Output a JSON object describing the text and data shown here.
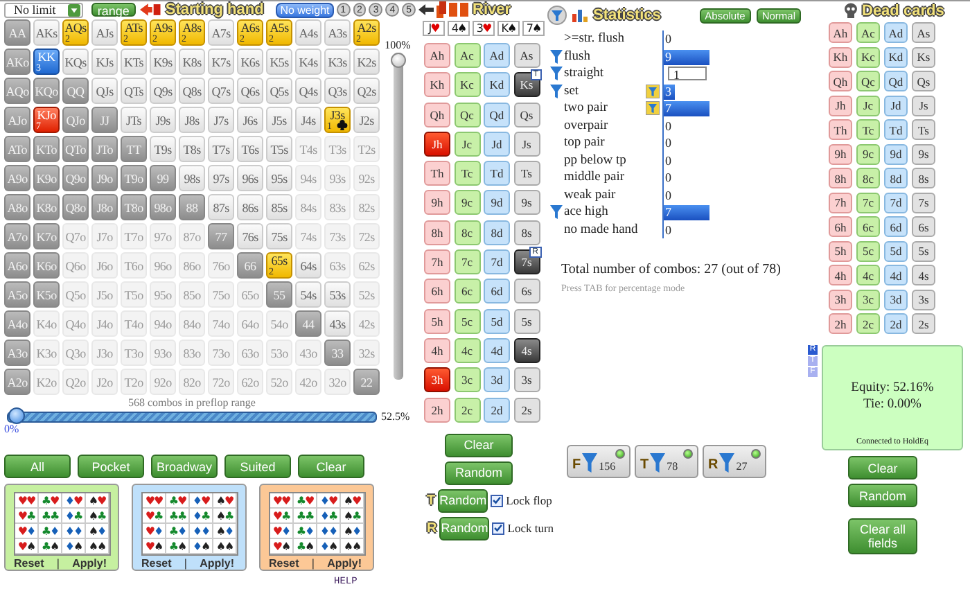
{
  "toolbar": {
    "game": "No limit",
    "range_button": "range",
    "title": "Starting hand",
    "weight_button": "No weight",
    "weight_slots": [
      "1",
      "2",
      "3",
      "4",
      "5"
    ]
  },
  "hand_grid": [
    [
      {
        "label": "AA",
        "kind": "in"
      },
      {
        "label": "AKs",
        "kind": "out"
      },
      {
        "label": "AQs",
        "kind": "gold",
        "weight": "2"
      },
      {
        "label": "AJs",
        "kind": "out"
      },
      {
        "label": "ATs",
        "kind": "gold",
        "weight": "2"
      },
      {
        "label": "A9s",
        "kind": "gold",
        "weight": "2"
      },
      {
        "label": "A8s",
        "kind": "gold",
        "weight": "2"
      },
      {
        "label": "A7s",
        "kind": "out"
      },
      {
        "label": "A6s",
        "kind": "gold",
        "weight": "2"
      },
      {
        "label": "A5s",
        "kind": "gold",
        "weight": "2"
      },
      {
        "label": "A4s",
        "kind": "out"
      },
      {
        "label": "A3s",
        "kind": "out"
      },
      {
        "label": "A2s",
        "kind": "gold",
        "weight": "2"
      }
    ],
    [
      {
        "label": "AKo",
        "kind": "in"
      },
      {
        "label": "KK",
        "kind": "blue",
        "weight": "3"
      },
      {
        "label": "KQs",
        "kind": "out"
      },
      {
        "label": "KJs",
        "kind": "out"
      },
      {
        "label": "KTs",
        "kind": "out"
      },
      {
        "label": "K9s",
        "kind": "out"
      },
      {
        "label": "K8s",
        "kind": "out"
      },
      {
        "label": "K7s",
        "kind": "out"
      },
      {
        "label": "K6s",
        "kind": "out"
      },
      {
        "label": "K5s",
        "kind": "out"
      },
      {
        "label": "K4s",
        "kind": "out"
      },
      {
        "label": "K3s",
        "kind": "out"
      },
      {
        "label": "K2s",
        "kind": "out"
      }
    ],
    [
      {
        "label": "AQo",
        "kind": "in"
      },
      {
        "label": "KQo",
        "kind": "in"
      },
      {
        "label": "QQ",
        "kind": "in"
      },
      {
        "label": "QJs",
        "kind": "out"
      },
      {
        "label": "QTs",
        "kind": "out"
      },
      {
        "label": "Q9s",
        "kind": "out"
      },
      {
        "label": "Q8s",
        "kind": "out"
      },
      {
        "label": "Q7s",
        "kind": "out"
      },
      {
        "label": "Q6s",
        "kind": "out"
      },
      {
        "label": "Q5s",
        "kind": "out"
      },
      {
        "label": "Q4s",
        "kind": "out"
      },
      {
        "label": "Q3s",
        "kind": "out"
      },
      {
        "label": "Q2s",
        "kind": "out"
      }
    ],
    [
      {
        "label": "AJo",
        "kind": "in"
      },
      {
        "label": "KJo",
        "kind": "red",
        "weight": "7"
      },
      {
        "label": "QJo",
        "kind": "in"
      },
      {
        "label": "JJ",
        "kind": "in"
      },
      {
        "label": "JTs",
        "kind": "out"
      },
      {
        "label": "J9s",
        "kind": "out"
      },
      {
        "label": "J8s",
        "kind": "out"
      },
      {
        "label": "J7s",
        "kind": "out"
      },
      {
        "label": "J6s",
        "kind": "out"
      },
      {
        "label": "J5s",
        "kind": "out"
      },
      {
        "label": "J4s",
        "kind": "out"
      },
      {
        "label": "J3s",
        "kind": "gold-marked",
        "weight": "1"
      },
      {
        "label": "J2s",
        "kind": "out"
      }
    ],
    [
      {
        "label": "ATo",
        "kind": "in"
      },
      {
        "label": "KTo",
        "kind": "in"
      },
      {
        "label": "QTo",
        "kind": "in"
      },
      {
        "label": "JTo",
        "kind": "in"
      },
      {
        "label": "TT",
        "kind": "in"
      },
      {
        "label": "T9s",
        "kind": "out"
      },
      {
        "label": "T8s",
        "kind": "out"
      },
      {
        "label": "T7s",
        "kind": "out"
      },
      {
        "label": "T6s",
        "kind": "out"
      },
      {
        "label": "T5s",
        "kind": "out"
      },
      {
        "label": "T4s",
        "kind": "dim"
      },
      {
        "label": "T3s",
        "kind": "dim"
      },
      {
        "label": "T2s",
        "kind": "dim"
      }
    ],
    [
      {
        "label": "A9o",
        "kind": "in"
      },
      {
        "label": "K9o",
        "kind": "in"
      },
      {
        "label": "Q9o",
        "kind": "in"
      },
      {
        "label": "J9o",
        "kind": "in"
      },
      {
        "label": "T9o",
        "kind": "in"
      },
      {
        "label": "99",
        "kind": "in"
      },
      {
        "label": "98s",
        "kind": "out"
      },
      {
        "label": "97s",
        "kind": "out"
      },
      {
        "label": "96s",
        "kind": "out"
      },
      {
        "label": "95s",
        "kind": "out"
      },
      {
        "label": "94s",
        "kind": "dim"
      },
      {
        "label": "93s",
        "kind": "dim"
      },
      {
        "label": "92s",
        "kind": "dim"
      }
    ],
    [
      {
        "label": "A8o",
        "kind": "in"
      },
      {
        "label": "K8o",
        "kind": "in"
      },
      {
        "label": "Q8o",
        "kind": "in"
      },
      {
        "label": "J8o",
        "kind": "in"
      },
      {
        "label": "T8o",
        "kind": "in"
      },
      {
        "label": "98o",
        "kind": "in"
      },
      {
        "label": "88",
        "kind": "in"
      },
      {
        "label": "87s",
        "kind": "out"
      },
      {
        "label": "86s",
        "kind": "out"
      },
      {
        "label": "85s",
        "kind": "out"
      },
      {
        "label": "84s",
        "kind": "dim"
      },
      {
        "label": "83s",
        "kind": "dim"
      },
      {
        "label": "82s",
        "kind": "dim"
      }
    ],
    [
      {
        "label": "A7o",
        "kind": "in"
      },
      {
        "label": "K7o",
        "kind": "in"
      },
      {
        "label": "Q7o",
        "kind": "dim"
      },
      {
        "label": "J7o",
        "kind": "dim"
      },
      {
        "label": "T7o",
        "kind": "dim"
      },
      {
        "label": "97o",
        "kind": "dim"
      },
      {
        "label": "87o",
        "kind": "dim"
      },
      {
        "label": "77",
        "kind": "in"
      },
      {
        "label": "76s",
        "kind": "out"
      },
      {
        "label": "75s",
        "kind": "out"
      },
      {
        "label": "74s",
        "kind": "dim"
      },
      {
        "label": "73s",
        "kind": "dim"
      },
      {
        "label": "72s",
        "kind": "dim"
      }
    ],
    [
      {
        "label": "A6o",
        "kind": "in"
      },
      {
        "label": "K6o",
        "kind": "in"
      },
      {
        "label": "Q6o",
        "kind": "dim"
      },
      {
        "label": "J6o",
        "kind": "dim"
      },
      {
        "label": "T6o",
        "kind": "dim"
      },
      {
        "label": "96o",
        "kind": "dim"
      },
      {
        "label": "86o",
        "kind": "dim"
      },
      {
        "label": "76o",
        "kind": "dim"
      },
      {
        "label": "66",
        "kind": "in"
      },
      {
        "label": "65s",
        "kind": "gold",
        "weight": "2"
      },
      {
        "label": "64s",
        "kind": "out"
      },
      {
        "label": "63s",
        "kind": "dim"
      },
      {
        "label": "62s",
        "kind": "dim"
      }
    ],
    [
      {
        "label": "A5o",
        "kind": "in"
      },
      {
        "label": "K5o",
        "kind": "in"
      },
      {
        "label": "Q5o",
        "kind": "dim"
      },
      {
        "label": "J5o",
        "kind": "dim"
      },
      {
        "label": "T5o",
        "kind": "dim"
      },
      {
        "label": "95o",
        "kind": "dim"
      },
      {
        "label": "85o",
        "kind": "dim"
      },
      {
        "label": "75o",
        "kind": "dim"
      },
      {
        "label": "65o",
        "kind": "dim"
      },
      {
        "label": "55",
        "kind": "in"
      },
      {
        "label": "54s",
        "kind": "out"
      },
      {
        "label": "53s",
        "kind": "out"
      },
      {
        "label": "52s",
        "kind": "dim"
      }
    ],
    [
      {
        "label": "A4o",
        "kind": "in"
      },
      {
        "label": "K4o",
        "kind": "dim"
      },
      {
        "label": "Q4o",
        "kind": "dim"
      },
      {
        "label": "J4o",
        "kind": "dim"
      },
      {
        "label": "T4o",
        "kind": "dim"
      },
      {
        "label": "94o",
        "kind": "dim"
      },
      {
        "label": "84o",
        "kind": "dim"
      },
      {
        "label": "74o",
        "kind": "dim"
      },
      {
        "label": "64o",
        "kind": "dim"
      },
      {
        "label": "54o",
        "kind": "dim"
      },
      {
        "label": "44",
        "kind": "in"
      },
      {
        "label": "43s",
        "kind": "out"
      },
      {
        "label": "42s",
        "kind": "dim"
      }
    ],
    [
      {
        "label": "A3o",
        "kind": "in"
      },
      {
        "label": "K3o",
        "kind": "dim"
      },
      {
        "label": "Q3o",
        "kind": "dim"
      },
      {
        "label": "J3o",
        "kind": "dim"
      },
      {
        "label": "T3o",
        "kind": "dim"
      },
      {
        "label": "93o",
        "kind": "dim"
      },
      {
        "label": "83o",
        "kind": "dim"
      },
      {
        "label": "73o",
        "kind": "dim"
      },
      {
        "label": "63o",
        "kind": "dim"
      },
      {
        "label": "53o",
        "kind": "dim"
      },
      {
        "label": "43o",
        "kind": "dim"
      },
      {
        "label": "33",
        "kind": "in"
      },
      {
        "label": "32s",
        "kind": "dim"
      }
    ],
    [
      {
        "label": "A2o",
        "kind": "in"
      },
      {
        "label": "K2o",
        "kind": "dim"
      },
      {
        "label": "Q2o",
        "kind": "dim"
      },
      {
        "label": "J2o",
        "kind": "dim"
      },
      {
        "label": "T2o",
        "kind": "dim"
      },
      {
        "label": "92o",
        "kind": "dim"
      },
      {
        "label": "82o",
        "kind": "dim"
      },
      {
        "label": "72o",
        "kind": "dim"
      },
      {
        "label": "62o",
        "kind": "dim"
      },
      {
        "label": "52o",
        "kind": "dim"
      },
      {
        "label": "42o",
        "kind": "dim"
      },
      {
        "label": "32o",
        "kind": "dim"
      },
      {
        "label": "22",
        "kind": "in"
      }
    ]
  ],
  "vertical_slider": {
    "label": "100%",
    "level": 1
  },
  "combos_text": "568 combos in preflop range",
  "horizontal_slider": {
    "min_label": "0%",
    "max_label": "52.5%",
    "level": 0
  },
  "range_buttons": [
    "All",
    "Pocket",
    "Broadway",
    "Suited",
    "Clear"
  ],
  "suit_panels": [
    {
      "color": "#c6f0a0",
      "reset": "Reset",
      "separator": "|",
      "apply": "Apply!",
      "cells": [
        [
          [
            {
              "symbol": "♥",
              "color": "#d81c1c"
            },
            {
              "symbol": "♥",
              "color": "#d81c1c"
            }
          ],
          [
            {
              "symbol": "♣",
              "color": "#14892c"
            },
            {
              "symbol": "♥",
              "color": "#d81c1c"
            }
          ],
          [
            {
              "symbol": "♦",
              "color": "#1660b8"
            },
            {
              "symbol": "♥",
              "color": "#d81c1c"
            }
          ],
          [
            {
              "symbol": "♠",
              "color": "#222222"
            },
            {
              "symbol": "♥",
              "color": "#d81c1c"
            }
          ]
        ],
        [
          [
            {
              "symbol": "♥",
              "color": "#d81c1c"
            },
            {
              "symbol": "♣",
              "color": "#14892c"
            }
          ],
          [
            {
              "symbol": "♣",
              "color": "#14892c"
            },
            {
              "symbol": "♣",
              "color": "#14892c"
            }
          ],
          [
            {
              "symbol": "♦",
              "color": "#1660b8"
            },
            {
              "symbol": "♣",
              "color": "#14892c"
            }
          ],
          [
            {
              "symbol": "♠",
              "color": "#222222"
            },
            {
              "symbol": "♣",
              "color": "#14892c"
            }
          ]
        ],
        [
          [
            {
              "symbol": "♥",
              "color": "#d81c1c"
            },
            {
              "symbol": "♦",
              "color": "#1660b8"
            }
          ],
          [
            {
              "symbol": "♣",
              "color": "#14892c"
            },
            {
              "symbol": "♦",
              "color": "#1660b8"
            }
          ],
          [
            {
              "symbol": "♦",
              "color": "#1660b8"
            },
            {
              "symbol": "♦",
              "color": "#1660b8"
            }
          ],
          [
            {
              "symbol": "♠",
              "color": "#222222"
            },
            {
              "symbol": "♦",
              "color": "#1660b8"
            }
          ]
        ],
        [
          [
            {
              "symbol": "♥",
              "color": "#d81c1c"
            },
            {
              "symbol": "♠",
              "color": "#222222"
            }
          ],
          [
            {
              "symbol": "♣",
              "color": "#14892c"
            },
            {
              "symbol": "♠",
              "color": "#222222"
            }
          ],
          [
            {
              "symbol": "♦",
              "color": "#1660b8"
            },
            {
              "symbol": "♠",
              "color": "#222222"
            }
          ],
          [
            {
              "symbol": "♠",
              "color": "#222222"
            },
            {
              "symbol": "♠",
              "color": "#222222"
            }
          ]
        ]
      ]
    },
    {
      "color": "#bfe0fa",
      "reset": "Reset",
      "separator": "|",
      "apply": "Apply!",
      "cells": [
        [
          [
            {
              "symbol": "♥",
              "color": "#d81c1c"
            },
            {
              "symbol": "♥",
              "color": "#d81c1c"
            }
          ],
          [
            {
              "symbol": "♣",
              "color": "#14892c"
            },
            {
              "symbol": "♥",
              "color": "#d81c1c"
            }
          ],
          [
            {
              "symbol": "♦",
              "color": "#1660b8"
            },
            {
              "symbol": "♥",
              "color": "#d81c1c"
            }
          ],
          [
            {
              "symbol": "♠",
              "color": "#222222"
            },
            {
              "symbol": "♥",
              "color": "#d81c1c"
            }
          ]
        ],
        [
          [
            {
              "symbol": "♥",
              "color": "#d81c1c"
            },
            {
              "symbol": "♣",
              "color": "#14892c"
            }
          ],
          [
            {
              "symbol": "♣",
              "color": "#14892c"
            },
            {
              "symbol": "♣",
              "color": "#14892c"
            }
          ],
          [
            {
              "symbol": "♦",
              "color": "#1660b8"
            },
            {
              "symbol": "♣",
              "color": "#14892c"
            }
          ],
          [
            {
              "symbol": "♠",
              "color": "#222222"
            },
            {
              "symbol": "♣",
              "color": "#14892c"
            }
          ]
        ],
        [
          [
            {
              "symbol": "♥",
              "color": "#d81c1c"
            },
            {
              "symbol": "♦",
              "color": "#1660b8"
            }
          ],
          [
            {
              "symbol": "♣",
              "color": "#14892c"
            },
            {
              "symbol": "♦",
              "color": "#1660b8"
            }
          ],
          [
            {
              "symbol": "♦",
              "color": "#1660b8"
            },
            {
              "symbol": "♦",
              "color": "#1660b8"
            }
          ],
          [
            {
              "symbol": "♠",
              "color": "#222222"
            },
            {
              "symbol": "♦",
              "color": "#1660b8"
            }
          ]
        ],
        [
          [
            {
              "symbol": "♥",
              "color": "#d81c1c"
            },
            {
              "symbol": "♠",
              "color": "#222222"
            }
          ],
          [
            {
              "symbol": "♣",
              "color": "#14892c"
            },
            {
              "symbol": "♠",
              "color": "#222222"
            }
          ],
          [
            {
              "symbol": "♦",
              "color": "#1660b8"
            },
            {
              "symbol": "♠",
              "color": "#222222"
            }
          ],
          [
            {
              "symbol": "♠",
              "color": "#222222"
            },
            {
              "symbol": "♠",
              "color": "#222222"
            }
          ]
        ]
      ]
    },
    {
      "color": "#fcc896",
      "reset": "Reset",
      "separator": "|",
      "apply": "Apply!",
      "cells": [
        [
          [
            {
              "symbol": "♥",
              "color": "#d81c1c"
            },
            {
              "symbol": "♥",
              "color": "#d81c1c"
            }
          ],
          [
            {
              "symbol": "♣",
              "color": "#14892c"
            },
            {
              "symbol": "♥",
              "color": "#d81c1c"
            }
          ],
          [
            {
              "symbol": "♦",
              "color": "#1660b8"
            },
            {
              "symbol": "♥",
              "color": "#d81c1c"
            }
          ],
          [
            {
              "symbol": "♠",
              "color": "#222222"
            },
            {
              "symbol": "♥",
              "color": "#d81c1c"
            }
          ]
        ],
        [
          [
            {
              "symbol": "♥",
              "color": "#d81c1c"
            },
            {
              "symbol": "♣",
              "color": "#14892c"
            }
          ],
          [
            {
              "symbol": "♣",
              "color": "#14892c"
            },
            {
              "symbol": "♣",
              "color": "#14892c"
            }
          ],
          [
            {
              "symbol": "♦",
              "color": "#1660b8"
            },
            {
              "symbol": "♣",
              "color": "#14892c"
            }
          ],
          [
            {
              "symbol": "♠",
              "color": "#222222"
            },
            {
              "symbol": "♣",
              "color": "#14892c"
            }
          ]
        ],
        [
          [
            {
              "symbol": "♥",
              "color": "#d81c1c"
            },
            {
              "symbol": "♦",
              "color": "#1660b8"
            }
          ],
          [
            {
              "symbol": "♣",
              "color": "#14892c"
            },
            {
              "symbol": "♦",
              "color": "#1660b8"
            }
          ],
          [
            {
              "symbol": "♦",
              "color": "#1660b8"
            },
            {
              "symbol": "♦",
              "color": "#1660b8"
            }
          ],
          [
            {
              "symbol": "♠",
              "color": "#222222"
            },
            {
              "symbol": "♦",
              "color": "#1660b8"
            }
          ]
        ],
        [
          [
            {
              "symbol": "♥",
              "color": "#d81c1c"
            },
            {
              "symbol": "♠",
              "color": "#222222"
            }
          ],
          [
            {
              "symbol": "♣",
              "color": "#14892c"
            },
            {
              "symbol": "♠",
              "color": "#222222"
            }
          ],
          [
            {
              "symbol": "♦",
              "color": "#1660b8"
            },
            {
              "symbol": "♠",
              "color": "#222222"
            }
          ],
          [
            {
              "symbol": "♠",
              "color": "#222222"
            },
            {
              "symbol": "♠",
              "color": "#222222"
            }
          ]
        ]
      ]
    }
  ],
  "help": "HELP",
  "river": {
    "title": "River",
    "board": [
      {
        "rank": "J",
        "suit": "♥",
        "color": "#e00000"
      },
      {
        "rank": "4",
        "suit": "♠",
        "color": "#111111"
      },
      {
        "rank": "3",
        "suit": "♥",
        "color": "#e00000"
      },
      {
        "rank": "K",
        "suit": "♠",
        "color": "#111111"
      },
      {
        "rank": "7",
        "suit": "♠",
        "color": "#111111"
      }
    ],
    "cards": [
      [
        {
          "label": "Ah",
          "kind": "hearts",
          "on_board": false
        },
        {
          "label": "Ac",
          "kind": "clubs",
          "on_board": false
        },
        {
          "label": "Ad",
          "kind": "diamonds",
          "on_board": false
        },
        {
          "label": "As",
          "kind": "spades",
          "on_board": false
        }
      ],
      [
        {
          "label": "Kh",
          "kind": "hearts",
          "on_board": false
        },
        {
          "label": "Kc",
          "kind": "clubs",
          "on_board": false
        },
        {
          "label": "Kd",
          "kind": "diamonds",
          "on_board": false
        },
        {
          "label": "Ks",
          "kind": "spades",
          "on_board": true,
          "badge": "T"
        }
      ],
      [
        {
          "label": "Qh",
          "kind": "hearts",
          "on_board": false
        },
        {
          "label": "Qc",
          "kind": "clubs",
          "on_board": false
        },
        {
          "label": "Qd",
          "kind": "diamonds",
          "on_board": false
        },
        {
          "label": "Qs",
          "kind": "spades",
          "on_board": false
        }
      ],
      [
        {
          "label": "Jh",
          "kind": "hearts",
          "on_board": true
        },
        {
          "label": "Jc",
          "kind": "clubs",
          "on_board": false
        },
        {
          "label": "Jd",
          "kind": "diamonds",
          "on_board": false
        },
        {
          "label": "Js",
          "kind": "spades",
          "on_board": false
        }
      ],
      [
        {
          "label": "Th",
          "kind": "hearts",
          "on_board": false
        },
        {
          "label": "Tc",
          "kind": "clubs",
          "on_board": false
        },
        {
          "label": "Td",
          "kind": "diamonds",
          "on_board": false
        },
        {
          "label": "Ts",
          "kind": "spades",
          "on_board": false
        }
      ],
      [
        {
          "label": "9h",
          "kind": "hearts",
          "on_board": false
        },
        {
          "label": "9c",
          "kind": "clubs",
          "on_board": false
        },
        {
          "label": "9d",
          "kind": "diamonds",
          "on_board": false
        },
        {
          "label": "9s",
          "kind": "spades",
          "on_board": false
        }
      ],
      [
        {
          "label": "8h",
          "kind": "hearts",
          "on_board": false
        },
        {
          "label": "8c",
          "kind": "clubs",
          "on_board": false
        },
        {
          "label": "8d",
          "kind": "diamonds",
          "on_board": false
        },
        {
          "label": "8s",
          "kind": "spades",
          "on_board": false
        }
      ],
      [
        {
          "label": "7h",
          "kind": "hearts",
          "on_board": false
        },
        {
          "label": "7c",
          "kind": "clubs",
          "on_board": false
        },
        {
          "label": "7d",
          "kind": "diamonds",
          "on_board": false
        },
        {
          "label": "7s",
          "kind": "spades",
          "on_board": true,
          "badge": "R"
        }
      ],
      [
        {
          "label": "6h",
          "kind": "hearts",
          "on_board": false
        },
        {
          "label": "6c",
          "kind": "clubs",
          "on_board": false
        },
        {
          "label": "6d",
          "kind": "diamonds",
          "on_board": false
        },
        {
          "label": "6s",
          "kind": "spades",
          "on_board": false
        }
      ],
      [
        {
          "label": "5h",
          "kind": "hearts",
          "on_board": false
        },
        {
          "label": "5c",
          "kind": "clubs",
          "on_board": false
        },
        {
          "label": "5d",
          "kind": "diamonds",
          "on_board": false
        },
        {
          "label": "5s",
          "kind": "spades",
          "on_board": false
        }
      ],
      [
        {
          "label": "4h",
          "kind": "hearts",
          "on_board": false
        },
        {
          "label": "4c",
          "kind": "clubs",
          "on_board": false
        },
        {
          "label": "4d",
          "kind": "diamonds",
          "on_board": false
        },
        {
          "label": "4s",
          "kind": "spades",
          "on_board": true
        }
      ],
      [
        {
          "label": "3h",
          "kind": "hearts",
          "on_board": true
        },
        {
          "label": "3c",
          "kind": "clubs",
          "on_board": false
        },
        {
          "label": "3d",
          "kind": "diamonds",
          "on_board": false
        },
        {
          "label": "3s",
          "kind": "spades",
          "on_board": false
        }
      ],
      [
        {
          "label": "2h",
          "kind": "hearts",
          "on_board": false
        },
        {
          "label": "2c",
          "kind": "clubs",
          "on_board": false
        },
        {
          "label": "2d",
          "kind": "diamonds",
          "on_board": false
        },
        {
          "label": "2s",
          "kind": "spades",
          "on_board": false
        }
      ]
    ]
  },
  "card_buttons": {
    "clear": "Clear",
    "random": "Random",
    "locks": [
      {
        "tag": "T",
        "button": "Random",
        "label": "Lock flop",
        "checked": true
      },
      {
        "tag": "R",
        "button": "Random",
        "label": "Lock turn",
        "checked": true
      }
    ]
  },
  "statistics": {
    "title": "Statistics",
    "modes": [
      "Absolute",
      "Normal"
    ],
    "rows": [
      {
        "label": ">=str. flush",
        "value": "0",
        "kind": "bar",
        "filtered": false,
        "pinned": false
      },
      {
        "label": "flush",
        "value": "9",
        "kind": "bar",
        "level": 0.33,
        "filtered": true,
        "pinned": false
      },
      {
        "label": "straight",
        "value": "1",
        "kind": "field",
        "filtered": true,
        "pinned": false
      },
      {
        "label": "set",
        "value": "3",
        "kind": "bar",
        "level": 0.08,
        "filtered": true,
        "pinned": true
      },
      {
        "label": "two pair",
        "value": "7",
        "kind": "bar",
        "level": 0.33,
        "filtered": false,
        "pinned": true
      },
      {
        "label": "overpair",
        "value": "0",
        "kind": "bar",
        "filtered": false,
        "pinned": false
      },
      {
        "label": "top pair",
        "value": "0",
        "kind": "bar",
        "filtered": false,
        "pinned": false
      },
      {
        "label": "pp below tp",
        "value": "0",
        "kind": "bar",
        "filtered": false,
        "pinned": false
      },
      {
        "label": "middle pair",
        "value": "0",
        "kind": "bar",
        "filtered": false,
        "pinned": false
      },
      {
        "label": "weak pair",
        "value": "0",
        "kind": "bar",
        "filtered": false,
        "pinned": false
      },
      {
        "label": "ace high",
        "value": "7",
        "kind": "bar",
        "level": 0.33,
        "filtered": true,
        "pinned": false
      },
      {
        "label": "no made hand",
        "value": "0",
        "kind": "bar",
        "filtered": false,
        "pinned": false
      }
    ],
    "total": "Total number of combos: 27 (out of 78)",
    "hint": "Press TAB for percentage mode"
  },
  "filters": [
    {
      "tag": "F",
      "count": "156",
      "on": true
    },
    {
      "tag": "T",
      "count": "78",
      "on": true
    },
    {
      "tag": "R",
      "count": "27",
      "on": true
    }
  ],
  "dead_cards": {
    "title": "Dead cards",
    "cards": [
      [
        {
          "label": "Ah",
          "kind": "hearts"
        },
        {
          "label": "Ac",
          "kind": "clubs"
        },
        {
          "label": "Ad",
          "kind": "diamonds"
        },
        {
          "label": "As",
          "kind": "spades"
        }
      ],
      [
        {
          "label": "Kh",
          "kind": "hearts"
        },
        {
          "label": "Kc",
          "kind": "clubs"
        },
        {
          "label": "Kd",
          "kind": "diamonds"
        },
        {
          "label": "Ks",
          "kind": "spades"
        }
      ],
      [
        {
          "label": "Qh",
          "kind": "hearts"
        },
        {
          "label": "Qc",
          "kind": "clubs"
        },
        {
          "label": "Qd",
          "kind": "diamonds"
        },
        {
          "label": "Qs",
          "kind": "spades"
        }
      ],
      [
        {
          "label": "Jh",
          "kind": "hearts"
        },
        {
          "label": "Jc",
          "kind": "clubs"
        },
        {
          "label": "Jd",
          "kind": "diamonds"
        },
        {
          "label": "Js",
          "kind": "spades"
        }
      ],
      [
        {
          "label": "Th",
          "kind": "hearts"
        },
        {
          "label": "Tc",
          "kind": "clubs"
        },
        {
          "label": "Td",
          "kind": "diamonds"
        },
        {
          "label": "Ts",
          "kind": "spades"
        }
      ],
      [
        {
          "label": "9h",
          "kind": "hearts"
        },
        {
          "label": "9c",
          "kind": "clubs"
        },
        {
          "label": "9d",
          "kind": "diamonds"
        },
        {
          "label": "9s",
          "kind": "spades"
        }
      ],
      [
        {
          "label": "8h",
          "kind": "hearts"
        },
        {
          "label": "8c",
          "kind": "clubs"
        },
        {
          "label": "8d",
          "kind": "diamonds"
        },
        {
          "label": "8s",
          "kind": "spades"
        }
      ],
      [
        {
          "label": "7h",
          "kind": "hearts"
        },
        {
          "label": "7c",
          "kind": "clubs"
        },
        {
          "label": "7d",
          "kind": "diamonds"
        },
        {
          "label": "7s",
          "kind": "spades"
        }
      ],
      [
        {
          "label": "6h",
          "kind": "hearts"
        },
        {
          "label": "6c",
          "kind": "clubs"
        },
        {
          "label": "6d",
          "kind": "diamonds"
        },
        {
          "label": "6s",
          "kind": "spades"
        }
      ],
      [
        {
          "label": "5h",
          "kind": "hearts"
        },
        {
          "label": "5c",
          "kind": "clubs"
        },
        {
          "label": "5d",
          "kind": "diamonds"
        },
        {
          "label": "5s",
          "kind": "spades"
        }
      ],
      [
        {
          "label": "4h",
          "kind": "hearts"
        },
        {
          "label": "4c",
          "kind": "clubs"
        },
        {
          "label": "4d",
          "kind": "diamonds"
        },
        {
          "label": "4s",
          "kind": "spades"
        }
      ],
      [
        {
          "label": "3h",
          "kind": "hearts"
        },
        {
          "label": "3c",
          "kind": "clubs"
        },
        {
          "label": "3d",
          "kind": "diamonds"
        },
        {
          "label": "3s",
          "kind": "spades"
        }
      ],
      [
        {
          "label": "2h",
          "kind": "hearts"
        },
        {
          "label": "2c",
          "kind": "clubs"
        },
        {
          "label": "2d",
          "kind": "diamonds"
        },
        {
          "label": "2s",
          "kind": "spades"
        }
      ]
    ]
  },
  "equity": {
    "streets": [
      {
        "tag": "R",
        "selected": true
      },
      {
        "tag": "T",
        "selected": false
      },
      {
        "tag": "F",
        "selected": false
      }
    ],
    "equity": "Equity: 52.16%",
    "tie": "Tie: 0.00%",
    "status": "Connected to HoldEq"
  },
  "dead_buttons": [
    "Clear",
    "Random",
    "Clear all fields"
  ]
}
